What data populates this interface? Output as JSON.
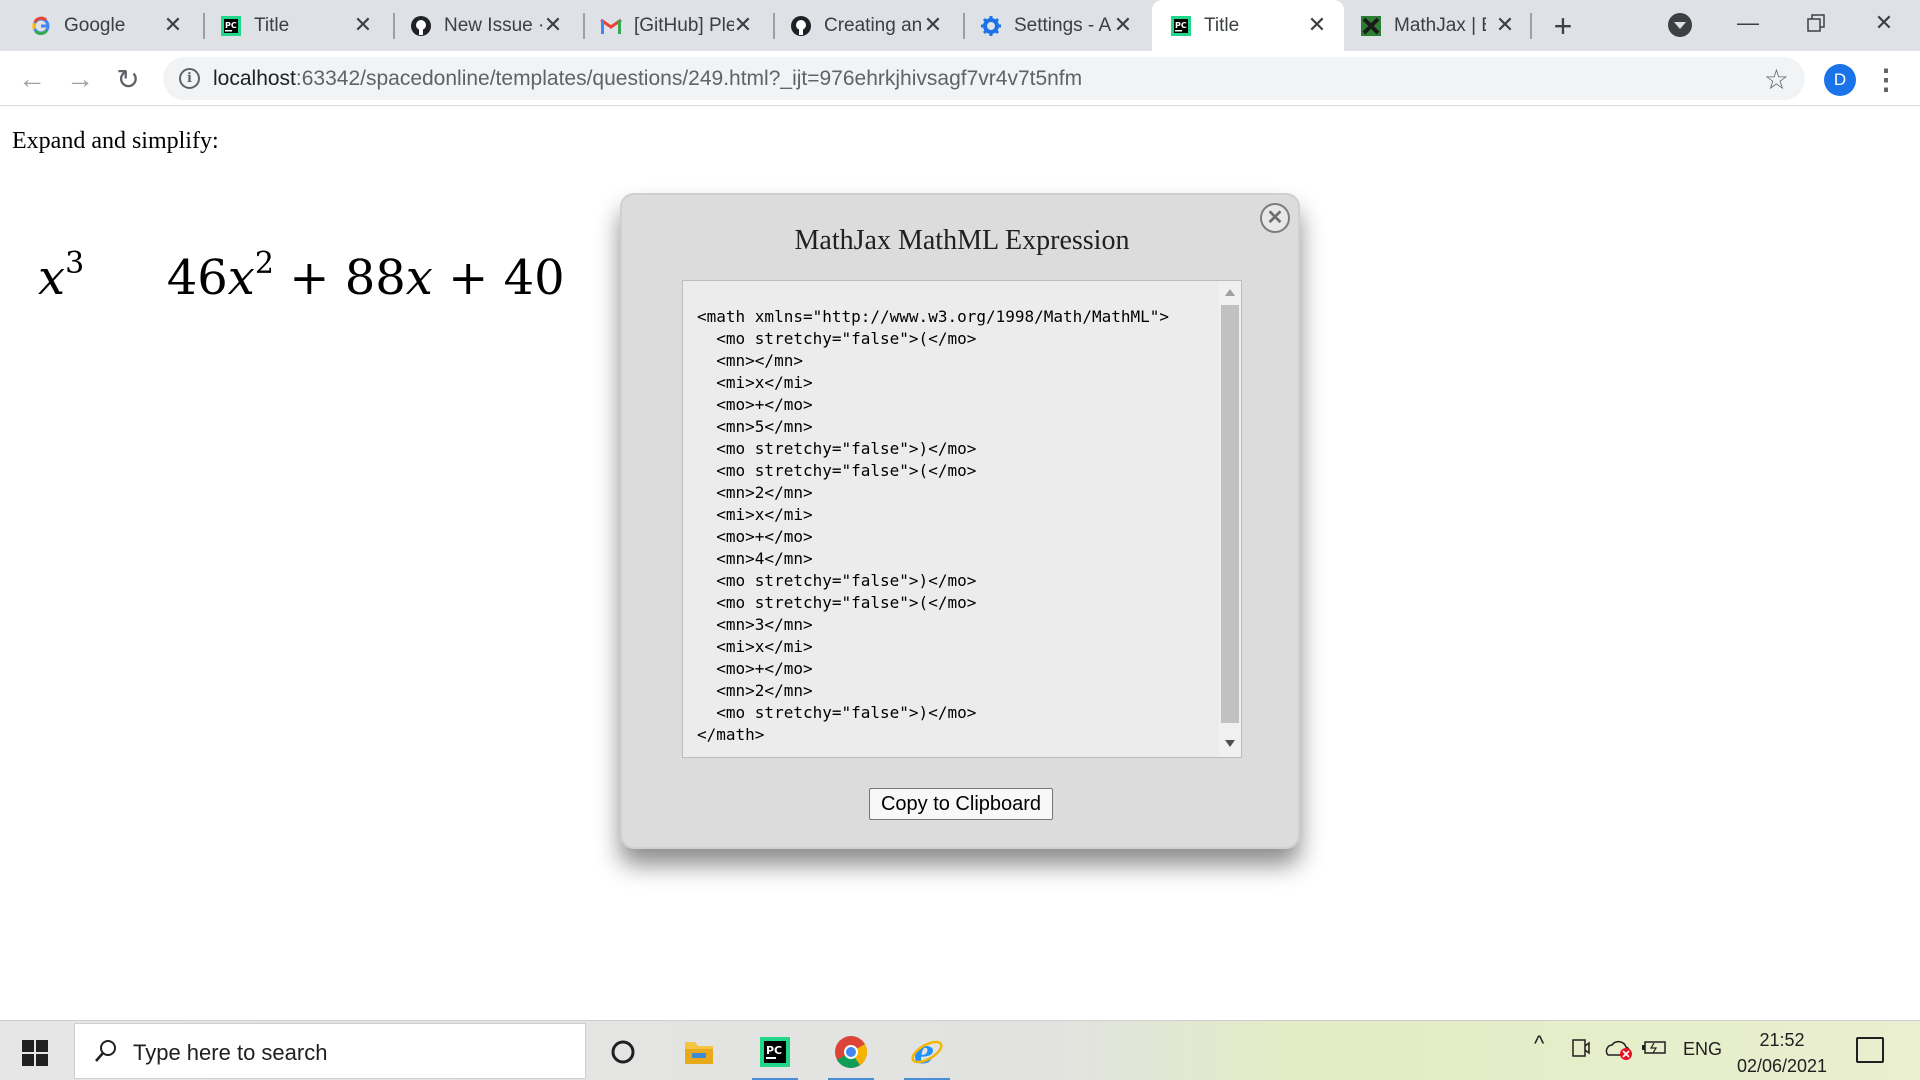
{
  "browser": {
    "tabs": [
      {
        "title": "Google",
        "icon": "google-icon",
        "active": false
      },
      {
        "title": "Title",
        "icon": "pycharm-icon",
        "active": false
      },
      {
        "title": "New Issue ·",
        "icon": "github-icon",
        "active": false
      },
      {
        "title": "[GitHub] Ple",
        "icon": "gmail-icon",
        "active": false
      },
      {
        "title": "Creating an",
        "icon": "github-icon",
        "active": false
      },
      {
        "title": "Settings - A",
        "icon": "gear-icon",
        "active": false
      },
      {
        "title": "Title",
        "icon": "pycharm-icon",
        "active": true
      },
      {
        "title": "MathJax | B",
        "icon": "mathjax-icon",
        "active": false
      }
    ],
    "url_host": "localhost",
    "url_rest": ":63342/spacedonline/templates/questions/249.html?_ijt=976ehrkjhivsagf7vr4v7t5nfm",
    "profile_initial": "D"
  },
  "page": {
    "prompt": "Expand and simplify:",
    "expression": {
      "t1_var": "x",
      "t1_exp": "3",
      "t2_coef": "46",
      "t2_var": "x",
      "t2_exp": "2",
      "plus1": "+",
      "t3": "88",
      "t3_var": "x",
      "plus2": "+",
      "t4": "40"
    }
  },
  "dialog": {
    "title": "MathJax MathML Expression",
    "code": "<math xmlns=\"http://www.w3.org/1998/Math/MathML\">\n  <mo stretchy=\"false\">(</mo>\n  <mn></mn>\n  <mi>x</mi>\n  <mo>+</mo>\n  <mn>5</mn>\n  <mo stretchy=\"false\">)</mo>\n  <mo stretchy=\"false\">(</mo>\n  <mn>2</mn>\n  <mi>x</mi>\n  <mo>+</mo>\n  <mn>4</mn>\n  <mo stretchy=\"false\">)</mo>\n  <mo stretchy=\"false\">(</mo>\n  <mn>3</mn>\n  <mi>x</mi>\n  <mo>+</mo>\n  <mn>2</mn>\n  <mo stretchy=\"false\">)</mo>\n</math>",
    "copy_button": "Copy to Clipboard"
  },
  "taskbar": {
    "search_placeholder": "Type here to search",
    "language": "ENG",
    "time": "21:52",
    "date": "02/06/2021"
  }
}
